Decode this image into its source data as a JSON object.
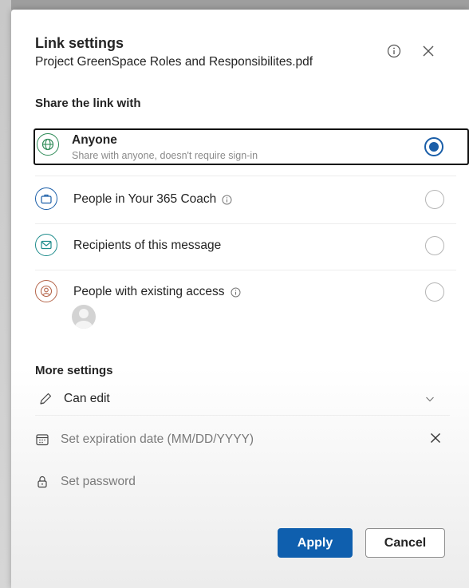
{
  "dialog": {
    "title": "Link settings",
    "filename": "Project GreenSpace Roles and Responsibilites.pdf"
  },
  "share_section": {
    "label": "Share the link with",
    "options": [
      {
        "label": "Anyone",
        "description": "Share with anyone, doesn't require sign-in",
        "icon": "globe-icon",
        "color": "#2e8b57",
        "selected": true
      },
      {
        "label": "People in Your 365 Coach",
        "icon": "briefcase-icon",
        "color": "#1a5ea8",
        "selected": false,
        "has_info": true
      },
      {
        "label": "Recipients of this message",
        "icon": "envelope-icon",
        "color": "#1e8c8c",
        "selected": false
      },
      {
        "label": "People with existing access",
        "icon": "person-icon",
        "color": "#b5654a",
        "selected": false,
        "has_info": true
      }
    ]
  },
  "more_settings": {
    "label": "More settings",
    "permission": "Can edit",
    "expiration_placeholder": "Set expiration date (MM/DD/YYYY)",
    "password_placeholder": "Set password"
  },
  "buttons": {
    "apply": "Apply",
    "cancel": "Cancel"
  },
  "colors": {
    "accent": "#0f5fae",
    "radio_selected": "#1a5ea8"
  }
}
